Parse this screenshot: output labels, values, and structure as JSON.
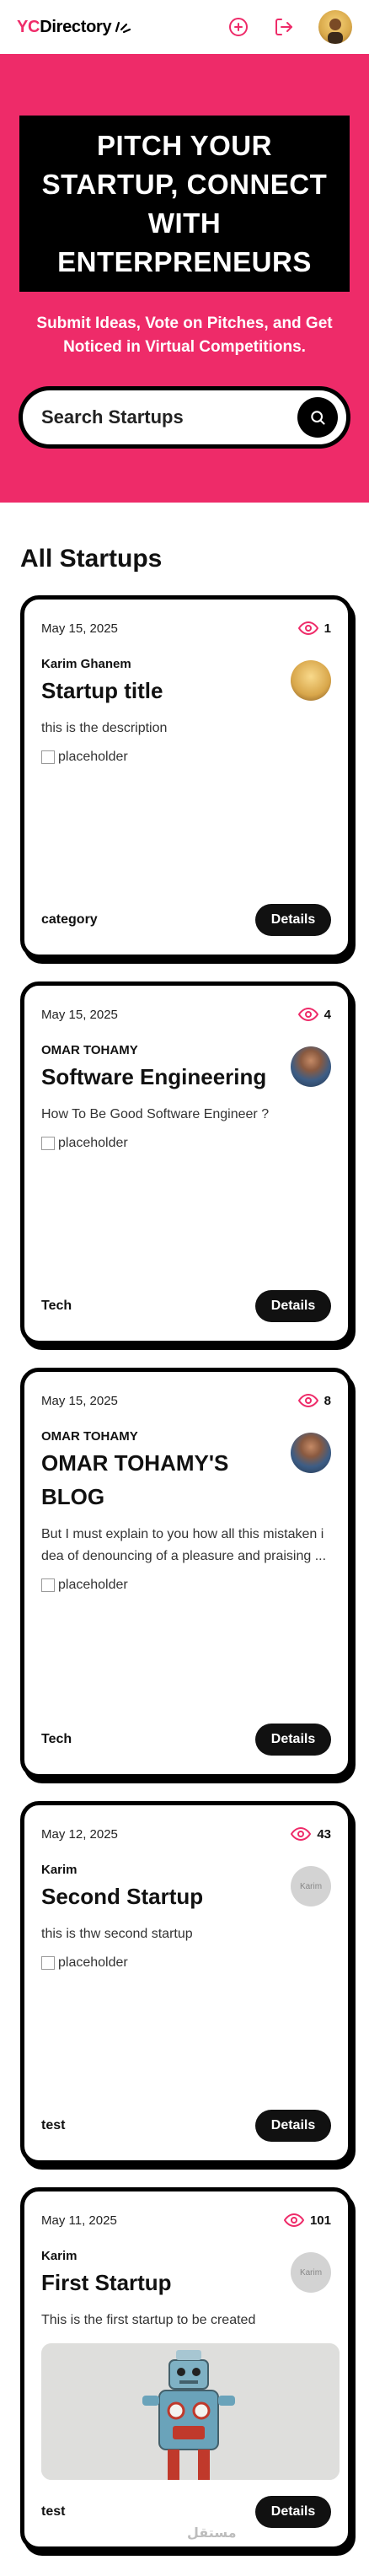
{
  "header": {
    "logo_yc": "YC",
    "logo_rest": "Directory",
    "create_icon": "plus-circle-icon",
    "logout_icon": "logout-icon"
  },
  "hero": {
    "title": "PITCH YOUR STARTUP, CONNECT WITH ENTERPRENEURS",
    "subtitle": "Submit Ideas, Vote on Pitches, and Get Noticed in Virtual Competitions.",
    "search_placeholder": "Search Startups"
  },
  "section_title": "All Startups",
  "colors": {
    "accent": "#ee2b69",
    "dark": "#000000"
  },
  "cards": [
    {
      "date": "May 15, 2025",
      "views": "1",
      "author": "Karim Ghanem",
      "title": "Startup title",
      "description": "this is the description",
      "image_alt": "placeholder",
      "category": "category",
      "details": "Details"
    },
    {
      "date": "May 15, 2025",
      "views": "4",
      "author": "OMAR TOHAMY",
      "title": "Software Engineering",
      "description": "How To Be Good Software Engineer ?",
      "image_alt": "placeholder",
      "category": "Tech",
      "details": "Details"
    },
    {
      "date": "May 15, 2025",
      "views": "8",
      "author": "OMAR TOHAMY",
      "title": "OMAR TOHAMY'S BLOG",
      "description": "But I must explain to you how all this mistaken idea of denouncing of a pleasure and praising ...",
      "image_alt": "placeholder",
      "category": "Tech",
      "details": "Details"
    },
    {
      "date": "May 12, 2025",
      "views": "43",
      "author": "Karim",
      "title": "Second Startup",
      "description": "this is thw second startup",
      "image_alt": "placeholder",
      "avatar_alt": "Karim",
      "category": "test",
      "details": "Details"
    },
    {
      "date": "May 11, 2025",
      "views": "101",
      "author": "Karim",
      "title": "First Startup",
      "description": "This is the first startup to be created",
      "avatar_alt": "Karim",
      "category": "test",
      "details": "Details",
      "watermark": "مستقل"
    }
  ]
}
